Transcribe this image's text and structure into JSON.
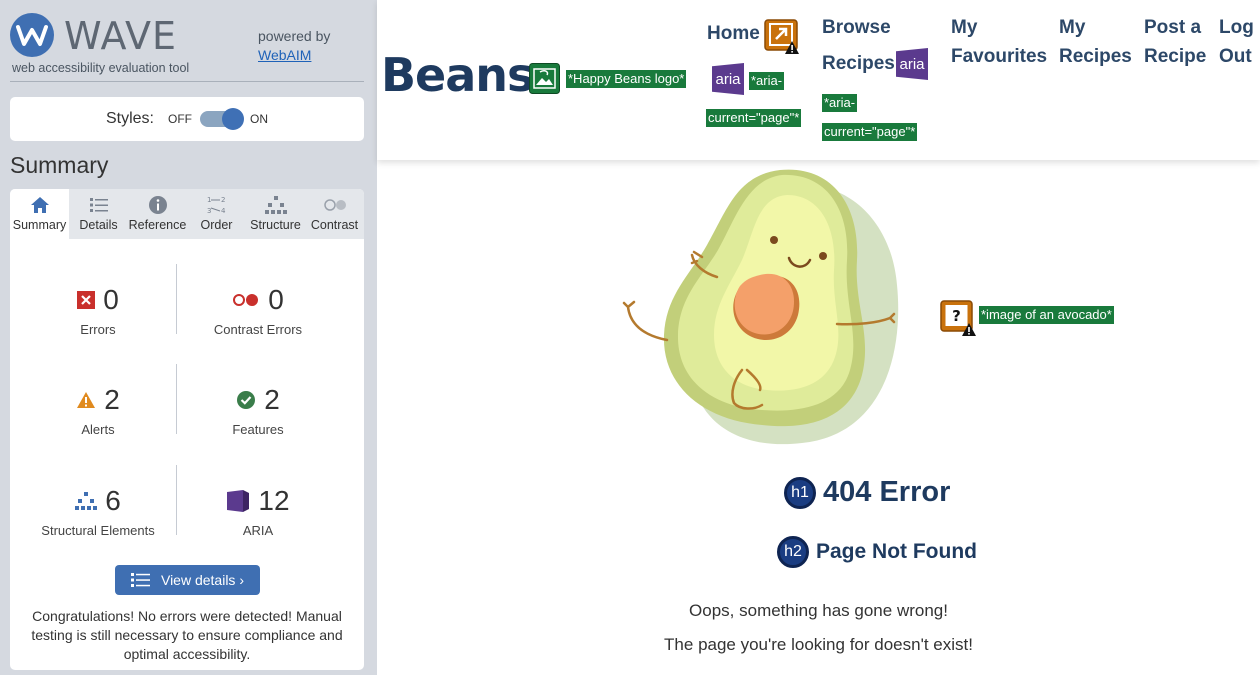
{
  "wave": {
    "name": "WAVE",
    "subtitle": "web accessibility evaluation tool",
    "powered_by": "powered by",
    "webaim": "WebAIM",
    "styles_label": "Styles:",
    "styles_off": "OFF",
    "styles_on": "ON",
    "styles_state": "on",
    "summary_title": "Summary",
    "tabs": [
      "Summary",
      "Details",
      "Reference",
      "Order",
      "Structure",
      "Contrast"
    ],
    "active_tab": "Summary",
    "stats": {
      "errors": {
        "count": "0",
        "label": "Errors"
      },
      "contrast_errors": {
        "count": "0",
        "label": "Contrast Errors"
      },
      "alerts": {
        "count": "2",
        "label": "Alerts"
      },
      "features": {
        "count": "2",
        "label": "Features"
      },
      "structural": {
        "count": "6",
        "label": "Structural Elements"
      },
      "aria": {
        "count": "12",
        "label": "ARIA"
      }
    },
    "view_details": "View details ›",
    "congrats": "Congratulations! No errors were detected! Manual testing is still necessary to ensure compliance and optimal accessibility.",
    "colors": {
      "panel_bg": "#d5d9e0",
      "accent": "#3f6fb2",
      "error": "#c9302c",
      "alert": "#e08a1e",
      "feature": "#3a7d4a",
      "aria": "#5b3a8e"
    }
  },
  "page": {
    "brand": "Beans",
    "logo_note": "*Happy Beans logo*",
    "nav": {
      "home": "Home",
      "browse_1": "Browse",
      "browse_2": "Recipes",
      "fav_1": "My",
      "fav_2": "Favourites",
      "myrec_1": "My",
      "myrec_2": "Recipes",
      "post_1": "Post a",
      "post_2": "Recipe",
      "logout_1": "Log",
      "logout_2": "Out"
    },
    "aria_label": "aria",
    "aria_current_1": "*aria-",
    "aria_current_2": "current=\"page\"*",
    "browse_aria_1": "*aria-",
    "browse_aria_2": "current=\"page\"*",
    "avocado_note": "*image of an avocado*",
    "h1_tag": "h1",
    "h1": "404 Error",
    "h2_tag": "h2",
    "h2": "Page Not Found",
    "p1": "Oops, something has gone wrong!",
    "p2": "The page you're looking for doesn't exist!",
    "colors": {
      "heading": "#1e3a5f",
      "note_bg": "#197a3c"
    }
  }
}
